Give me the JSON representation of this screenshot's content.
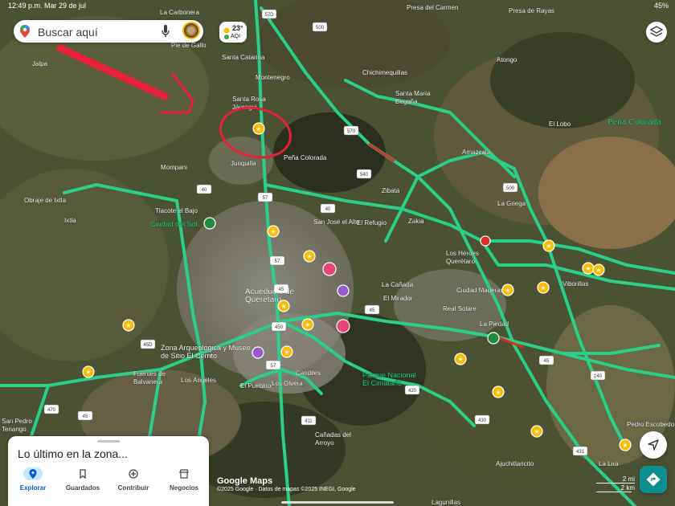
{
  "status_bar": {
    "time": "12:49 p.m.",
    "date": "Mar 29 de jul",
    "battery": "45%"
  },
  "search": {
    "placeholder": "Buscar aquí"
  },
  "weather": {
    "temp": "23°",
    "aqi": "AQI"
  },
  "places": [
    "La Carbonera",
    "Presa del Carmen",
    "Presa de Rayas",
    "Pie de Gallo",
    "Santa Catarina",
    "Jalpa",
    "Montenegro",
    "Chichimequillas",
    "Atongo",
    "Santa María Begoña",
    "Santa Rosa Jáuregui",
    "El Lobo",
    "Peña Colorada",
    "Peña Colorada",
    "Amazcala",
    "Juriquilla",
    "Mompani",
    "Zibatá",
    "Obraje de Ixtla",
    "La Griega",
    "Tlacote el Bajo",
    "Ixtla",
    "Ciudad del Sol",
    "San José el Alto",
    "El Refugio",
    "Zakia",
    "Los Héroes Querétaro",
    "Acueducto de Querétaro",
    "La Cañada",
    "Ciudad Maderas",
    "Viborillas",
    "El Mirador",
    "Real Solare",
    "La Piedad",
    "Zona Arqueológica y Museo de Sitio El Cerrito",
    "Fuentes de Balvanera",
    "Los Ángeles",
    "Candiles",
    "Parque Nacional El Cimatario",
    "El Pueblito",
    "Los Olvera",
    "San Pedro Tenango",
    "Cañadas del Arroyo",
    "Pedro Escobedo",
    "Ajuchitlancito",
    "La Lira",
    "Lagunillas"
  ],
  "route_shields": [
    "500",
    "57D",
    "570",
    "540",
    "57",
    "40",
    "500",
    "40",
    "57",
    "45",
    "450",
    "45D",
    "45",
    "57",
    "420",
    "411",
    "430",
    "431",
    "240",
    "45",
    "470",
    "45"
  ],
  "markers": {
    "star_color": "#fbbc04",
    "heart_color": "#e8457a",
    "attraction_color": "#9b59d0",
    "park_color": "#1e8e3e",
    "noentry_color": "#d93025"
  },
  "sheet": {
    "title": "Lo último en la zona...",
    "nav": [
      {
        "label": "Explorar",
        "icon": "location-pin-icon"
      },
      {
        "label": "Guardados",
        "icon": "bookmark-icon"
      },
      {
        "label": "Contribuir",
        "icon": "add-circle-icon"
      },
      {
        "label": "Negocios",
        "icon": "storefront-icon"
      }
    ]
  },
  "attribution": {
    "logo": "Google Maps",
    "credits": "©2025 Google · Datos de mapas ©2025 INEGI, Google"
  },
  "scale": {
    "miles": "2 mi",
    "km": "2 km"
  },
  "colors": {
    "traffic_green": "#2bcf8a",
    "traffic_red": "#d93025",
    "annotation_red": "#e8203a"
  }
}
